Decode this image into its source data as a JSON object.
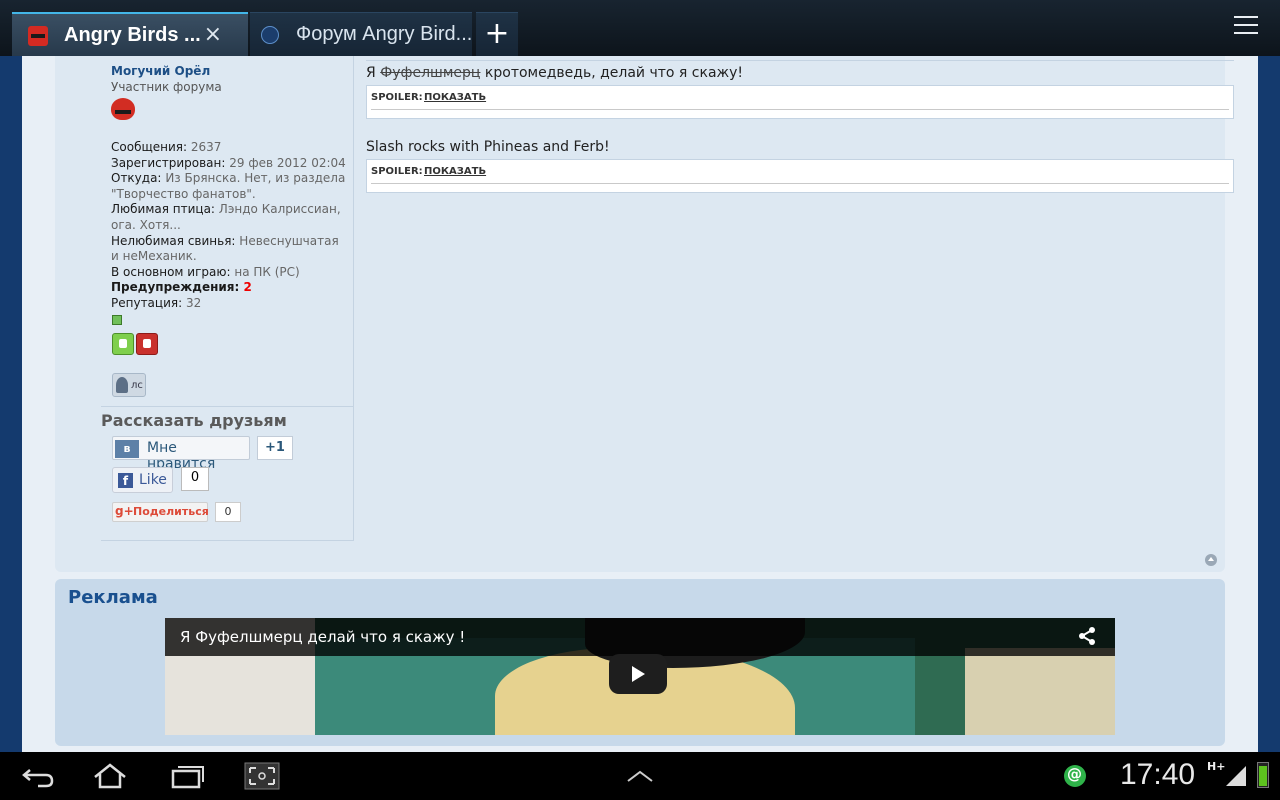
{
  "browser": {
    "tabs": [
      {
        "title": "Angry Birds ...",
        "active": true
      },
      {
        "title": "Форум Angry Bird...",
        "active": false
      }
    ],
    "new_tab": "+",
    "close": "×"
  },
  "profile": {
    "name": "Могучий Орёл",
    "rank": "Участник форума",
    "info": [
      {
        "label": "Сообщения:",
        "value": "2637"
      },
      {
        "label": "Зарегистрирован:",
        "value": "29 фев 2012 02:04"
      },
      {
        "label": "Откуда:",
        "value": "Из Брянска. Нет, из раздела \"Творчество фанатов\"."
      },
      {
        "label": "Любимая птица:",
        "value": "Лэндо Калриссиан, ога. Хотя..."
      },
      {
        "label": "Нелюбимая свинья:",
        "value": "Невеснушчатая и неМеханик."
      },
      {
        "label": "В основном играю:",
        "value": "на ПК (PC)"
      },
      {
        "label": "Предупреждения:",
        "value": "2"
      },
      {
        "label": "Репутация:",
        "value": "32"
      }
    ],
    "pm_label": "лс"
  },
  "share": {
    "title": "Рассказать друзьям",
    "vk_logo": "в",
    "vk_label": "Мне нравится",
    "vk_count": "+1",
    "fb_logo": "f",
    "fb_label": "Like",
    "fb_count": "0",
    "gp_logo": "g+",
    "gp_label": "Поделиться",
    "gp_count": "0"
  },
  "post": {
    "sig1_prefix": "Я",
    "sig1_strike": "Фуфелшмерц",
    "sig1_suffix": "кротомедведь, делай что я скажу!",
    "sig2": "Slash rocks with Phineas and Ferb!",
    "spoiler_label": "SPOILER:",
    "spoiler_link": "ПОКАЗАТЬ"
  },
  "ad": {
    "title": "Реклама",
    "video_caption": "Я Фуфелшмерц делай что я скажу !"
  },
  "status": {
    "time": "17:40",
    "network": "H+"
  }
}
